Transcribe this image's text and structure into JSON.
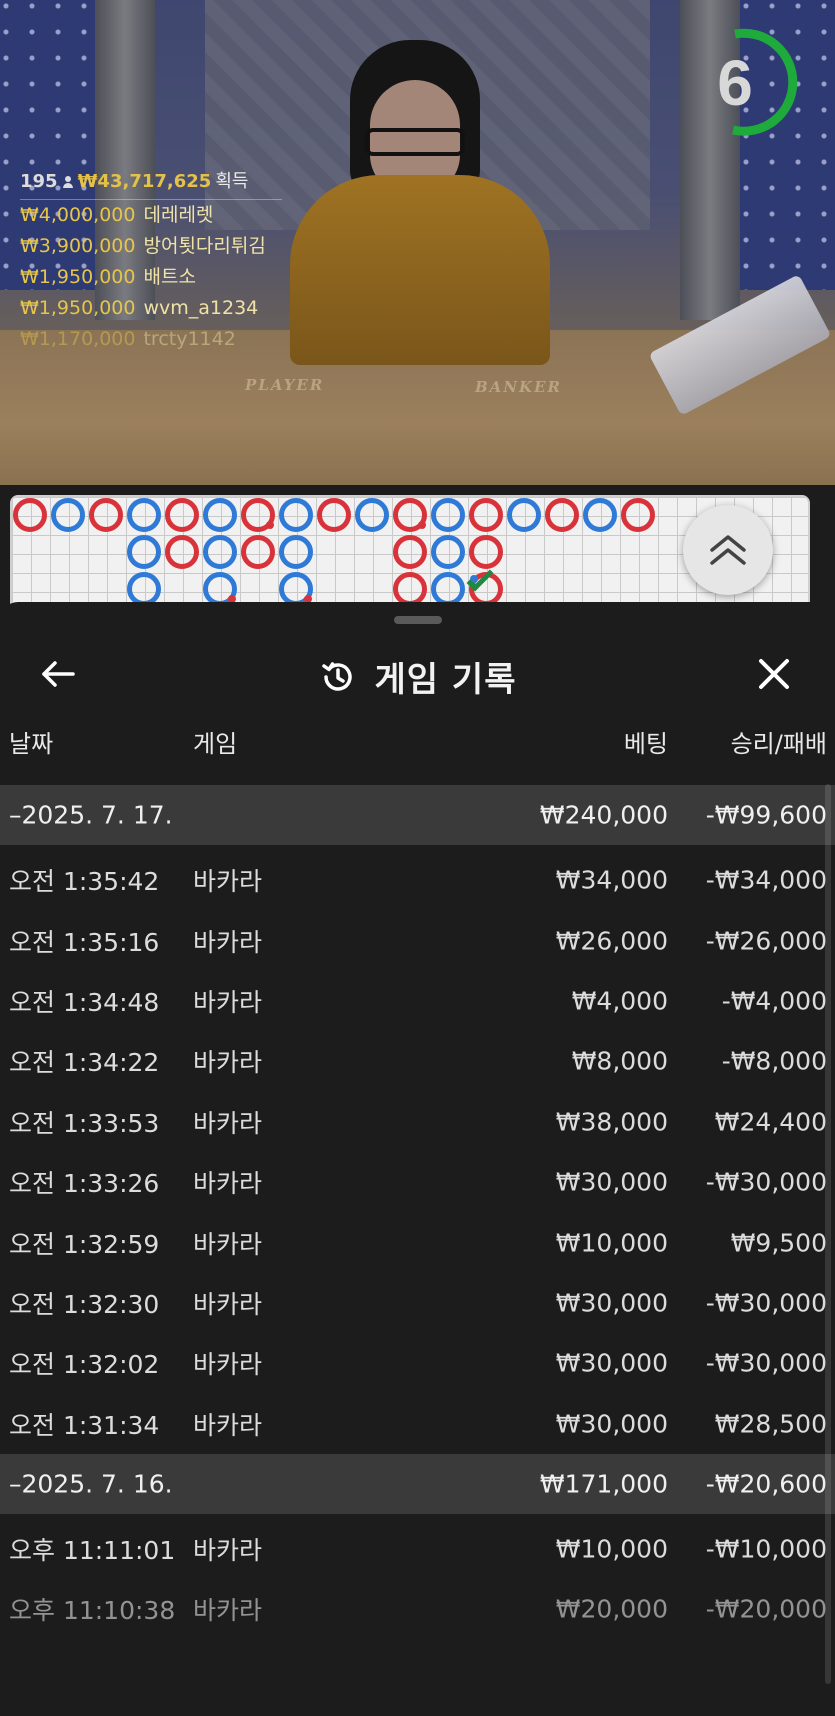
{
  "live": {
    "countdown": "6",
    "felt_player": "PLAYER",
    "felt_banker": "BANKER",
    "winners_header": {
      "count": "195",
      "total": "₩43,717,625",
      "label": "획득"
    },
    "winners": [
      {
        "amount": "₩4,000,000",
        "name": "데레레렛"
      },
      {
        "amount": "₩3,900,000",
        "name": "방어툇다리튀김"
      },
      {
        "amount": "₩1,950,000",
        "name": "배트소"
      },
      {
        "amount": "₩1,950,000",
        "name": "wvm_a1234"
      },
      {
        "amount": "₩1,170,000",
        "name": "trcty1142"
      }
    ]
  },
  "colors": {
    "banker": "#d8333a",
    "player": "#2f7ad6",
    "accent": "#e4c24a",
    "tie": "#1d8a42",
    "timer": "#1faa3c"
  },
  "icons": {
    "back": "arrow-left-icon",
    "history": "history-icon",
    "close": "close-icon",
    "expand": "chevrons-up-icon"
  },
  "history": {
    "title": "게임 기록",
    "columns": {
      "date": "날짜",
      "game": "게임",
      "bet": "베팅",
      "result": "승리/패배"
    },
    "groups": [
      {
        "date": "–2025. 7. 17.",
        "bet": "₩240,000",
        "result": "-₩99,600",
        "rows": [
          {
            "time": "오전 1:35:42",
            "game": "바카라",
            "bet": "₩34,000",
            "result": "-₩34,000"
          },
          {
            "time": "오전 1:35:16",
            "game": "바카라",
            "bet": "₩26,000",
            "result": "-₩26,000"
          },
          {
            "time": "오전 1:34:48",
            "game": "바카라",
            "bet": "₩4,000",
            "result": "-₩4,000"
          },
          {
            "time": "오전 1:34:22",
            "game": "바카라",
            "bet": "₩8,000",
            "result": "-₩8,000"
          },
          {
            "time": "오전 1:33:53",
            "game": "바카라",
            "bet": "₩38,000",
            "result": "₩24,400"
          },
          {
            "time": "오전 1:33:26",
            "game": "바카라",
            "bet": "₩30,000",
            "result": "-₩30,000"
          },
          {
            "time": "오전 1:32:59",
            "game": "바카라",
            "bet": "₩10,000",
            "result": "₩9,500"
          },
          {
            "time": "오전 1:32:30",
            "game": "바카라",
            "bet": "₩30,000",
            "result": "-₩30,000"
          },
          {
            "time": "오전 1:32:02",
            "game": "바카라",
            "bet": "₩30,000",
            "result": "-₩30,000"
          },
          {
            "time": "오전 1:31:34",
            "game": "바카라",
            "bet": "₩30,000",
            "result": "₩28,500"
          }
        ]
      },
      {
        "date": "–2025. 7. 16.",
        "bet": "₩171,000",
        "result": "-₩20,600",
        "rows": [
          {
            "time": "오후 11:11:01",
            "game": "바카라",
            "bet": "₩10,000",
            "result": "-₩10,000"
          },
          {
            "time": "오후 11:10:38",
            "game": "바카라",
            "bet": "₩20,000",
            "result": "-₩20,000"
          }
        ]
      }
    ]
  }
}
